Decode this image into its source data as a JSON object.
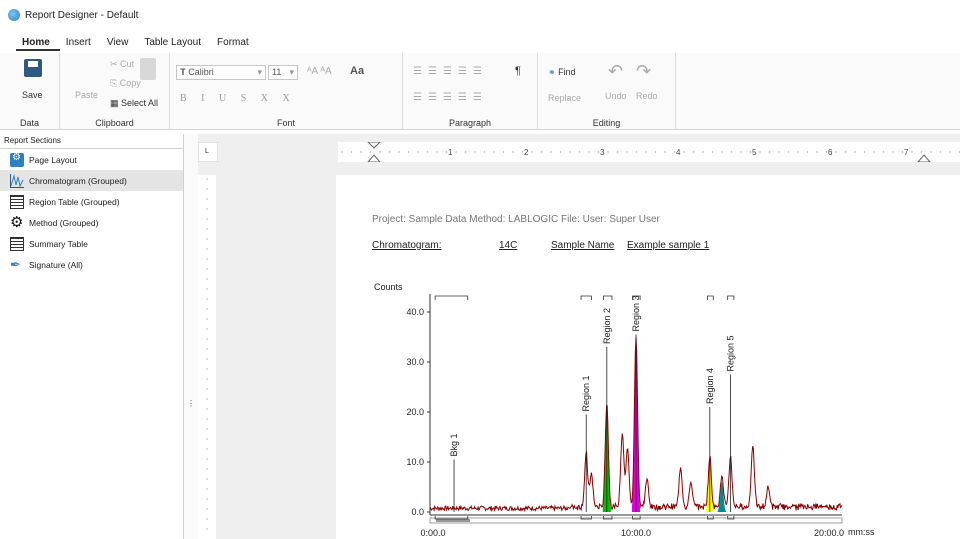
{
  "window": {
    "title": "Report Designer - Default"
  },
  "menu": [
    "Home",
    "Insert",
    "View",
    "Table Layout",
    "Format"
  ],
  "ribbon": {
    "data": {
      "label": "Data",
      "save": "Save"
    },
    "clipboard": {
      "label": "Clipboard",
      "paste": "Paste",
      "cut": "Cut",
      "copy": "Copy",
      "select_all": "Select All"
    },
    "font": {
      "label": "Font",
      "family": "Calibri",
      "size": "11",
      "format_glyphs": "B I U S X X",
      "case": "Aa"
    },
    "paragraph": {
      "label": "Paragraph",
      "pilcrow": "¶"
    },
    "editing": {
      "label": "Editing",
      "find": "Find",
      "replace": "Replace",
      "undo": "Undo",
      "redo": "Redo"
    }
  },
  "sidebar": {
    "header": "Report Sections",
    "items": [
      {
        "label": "Page Layout",
        "icon": "page-layout-icon"
      },
      {
        "label": "Chromatogram (Grouped)",
        "icon": "chromatogram-icon"
      },
      {
        "label": "Region Table (Grouped)",
        "icon": "table-icon"
      },
      {
        "label": "Method (Grouped)",
        "icon": "gear-icon"
      },
      {
        "label": "Summary Table",
        "icon": "table-icon"
      },
      {
        "label": "Signature (All)",
        "icon": "pen-icon"
      }
    ]
  },
  "ruler": {
    "numbers": [
      "1",
      "2",
      "3",
      "4",
      "5",
      "6",
      "7"
    ]
  },
  "report": {
    "project_line": "Project: Sample Data   Method: LABLOGIC   File:   User: Super User",
    "chromatogram_label": "Chromatogram:",
    "isotope": "14C",
    "sample_name_label": "Sample Name",
    "sample_name": "Example sample 1"
  },
  "chart_data": {
    "type": "line",
    "ylabel": "Counts",
    "xlabel": "mm:ss",
    "ylim": [
      0,
      40
    ],
    "xlim_seconds": [
      0,
      1200
    ],
    "y_ticks": [
      "0.0",
      "10.0",
      "20.0",
      "30.0",
      "40.0"
    ],
    "x_ticks": [
      {
        "label": "0:00.0",
        "value": 0
      },
      {
        "label": "10:00.0",
        "value": 600
      },
      {
        "label": "20:00.0",
        "value": 1200
      }
    ],
    "peaks": [
      {
        "t": 455,
        "h": 10.5
      },
      {
        "t": 470,
        "h": 6.5
      },
      {
        "t": 515,
        "h": 21.0,
        "fill": "#00c000"
      },
      {
        "t": 560,
        "h": 15.0
      },
      {
        "t": 575,
        "h": 12.0
      },
      {
        "t": 600,
        "h": 34.0,
        "fill": "#e000e0"
      },
      {
        "t": 632,
        "h": 5.5
      },
      {
        "t": 730,
        "h": 8.0
      },
      {
        "t": 760,
        "h": 5.0
      },
      {
        "t": 815,
        "h": 10.0,
        "fill": "#ffff00"
      },
      {
        "t": 850,
        "h": 6.0,
        "fill": "#008c8c"
      },
      {
        "t": 875,
        "h": 10.0
      },
      {
        "t": 940,
        "h": 12.5
      },
      {
        "t": 985,
        "h": 4.0
      }
    ],
    "regions": [
      {
        "name": "Bkg 1",
        "t": 70,
        "label_h": 10.5,
        "bracket": [
          15,
          110
        ]
      },
      {
        "name": "Region 1",
        "t": 455,
        "label_h": 19.5,
        "bracket": [
          440,
          470
        ]
      },
      {
        "name": "Region 2",
        "t": 515,
        "label_h": 33.0,
        "bracket": [
          505,
          530
        ]
      },
      {
        "name": "Region 3",
        "t": 600,
        "label_h": 35.5,
        "bracket": [
          590,
          612
        ]
      },
      {
        "name": "Region 4",
        "t": 815,
        "label_h": 21.0,
        "bracket": [
          808,
          825
        ]
      },
      {
        "name": "Region 5",
        "t": 875,
        "label_h": 27.5,
        "bracket": [
          867,
          885
        ]
      }
    ],
    "colors": {
      "trace": "#8b0000",
      "axis": "#333333"
    }
  }
}
